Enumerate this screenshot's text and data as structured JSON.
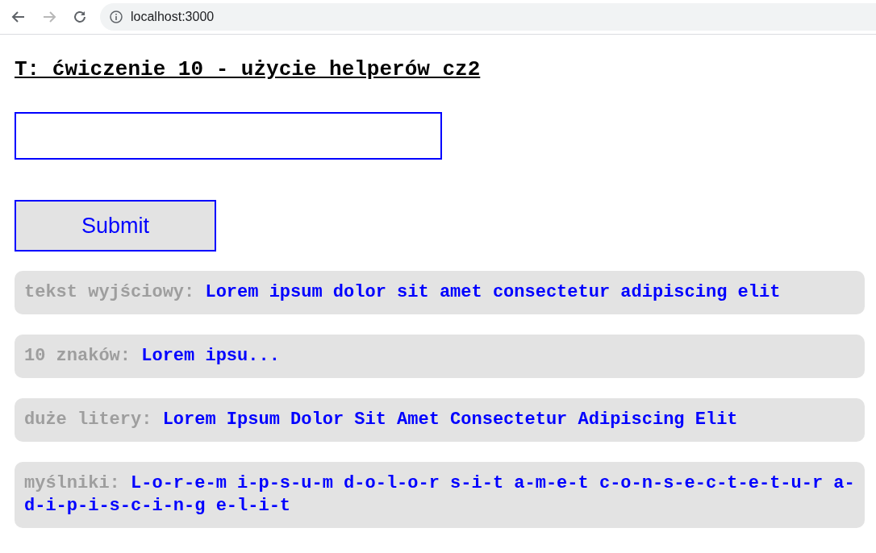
{
  "browser": {
    "back_disabled": false,
    "forward_disabled": true,
    "url": "localhost:3000"
  },
  "title": "T: ćwiczenie 10 - użycie helperów cz2",
  "form": {
    "button": "Submit"
  },
  "results": [
    {
      "label": "tekst wyjściowy:",
      "value": "Lorem ipsum dolor sit amet consectetur adipiscing elit"
    },
    {
      "label": "10 znaków:",
      "value": "Lorem ipsu..."
    },
    {
      "label": "duże litery:",
      "value": "Lorem Ipsum Dolor Sit Amet Consectetur Adipiscing Elit"
    },
    {
      "label": "myślniki:",
      "value": "L-o-r-e-m i-p-s-u-m d-o-l-o-r s-i-t a-m-e-t c-o-n-s-e-c-t-e-t-u-r a-d-i-p-i-s-c-i-n-g e-l-i-t"
    }
  ]
}
